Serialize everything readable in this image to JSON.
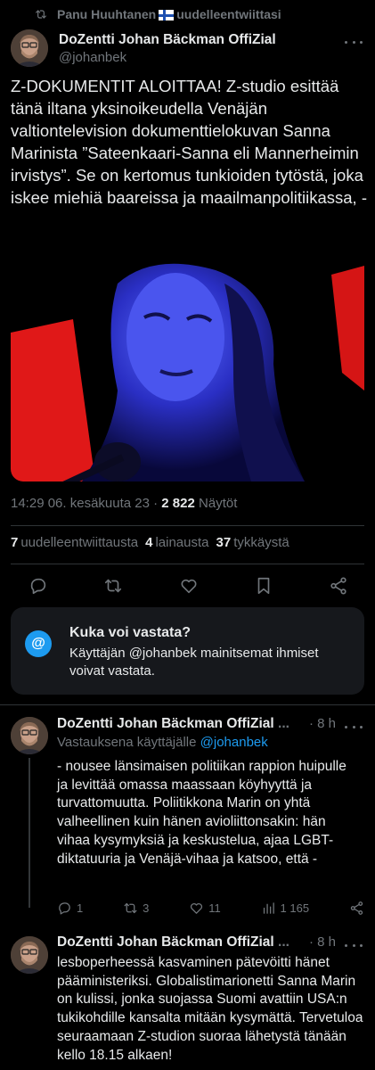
{
  "retweet": {
    "user": "Panu Huuhtanen",
    "action": "uudelleentwiittasi"
  },
  "main_tweet": {
    "author": "DoZentti Johan Bäckman OffiZial",
    "handle": "@johanbek",
    "text": "Z-DOKUMENTIT ALOITTAA! Z-studio esittää tänä iltana yksinoikeudella Venäjän valtiontelevision dokumenttielokuvan Sanna Marinista ”Sateenkaari-Sanna eli Mannerheimin irvistys”. Se on kertomus tunkioiden tytöstä, joka iskee miehiä baareissa ja maailmanpolitiikassa, -",
    "timestamp": "14:29 06. kesäkuuta 23 · ",
    "views_count": "2 822",
    "views_label": "Näytöt",
    "retweets_count": "7",
    "retweets_label": "uudelleentwiittausta",
    "quotes_count": "4",
    "quotes_label": "lainausta",
    "likes_count": "37",
    "likes_label": "tykkäystä"
  },
  "reply_restriction": {
    "icon": "at-icon",
    "badge": "@",
    "title": "Kuka voi vastata?",
    "text": "Käyttäjän @johanbek mainitsemat ihmiset voivat vastata."
  },
  "replies": [
    {
      "author": "DoZentti Johan Bäckman OffiZial",
      "ellipsis": "...",
      "time": "· 8 h",
      "replying_prefix": "Vastauksena käyttäjälle",
      "replying_to": "@johanbek",
      "text": "- nousee länsimaisen politiikan rappion huipulle ja levittää omassa maassaan köyhyyttä ja turvattomuutta. Poliitikkona Marin on yhtä valheellinen kuin hänen avioliittonsakin: hän vihaa kysymyksiä ja keskustelua, ajaa LGBT-diktatuuria ja Venäjä-vihaa ja katsoo, että -",
      "replies_count": "1",
      "retweets_count": "3",
      "likes_count": "11",
      "views_count": "1 165"
    },
    {
      "author": "DoZentti Johan Bäckman OffiZial",
      "ellipsis": "...",
      "time": "· 8 h",
      "text": "lesboperheessä kasvaminen pätevöitti hänet pääministeriksi. Globalistimarionetti Sanna Marin on kulissi, jonka suojassa Suomi avattiin USA:n tukikohdille kansalta mitään kysymättä. Tervetuloa seuraamaan Z-studion suoraa lähetystä tänään kello 18.15 alkaen!"
    }
  ],
  "colors": {
    "background": "#000000",
    "text": "#e7e9ea",
    "muted": "#71767b",
    "accent": "#1d9bf0",
    "card": "#16181c"
  }
}
